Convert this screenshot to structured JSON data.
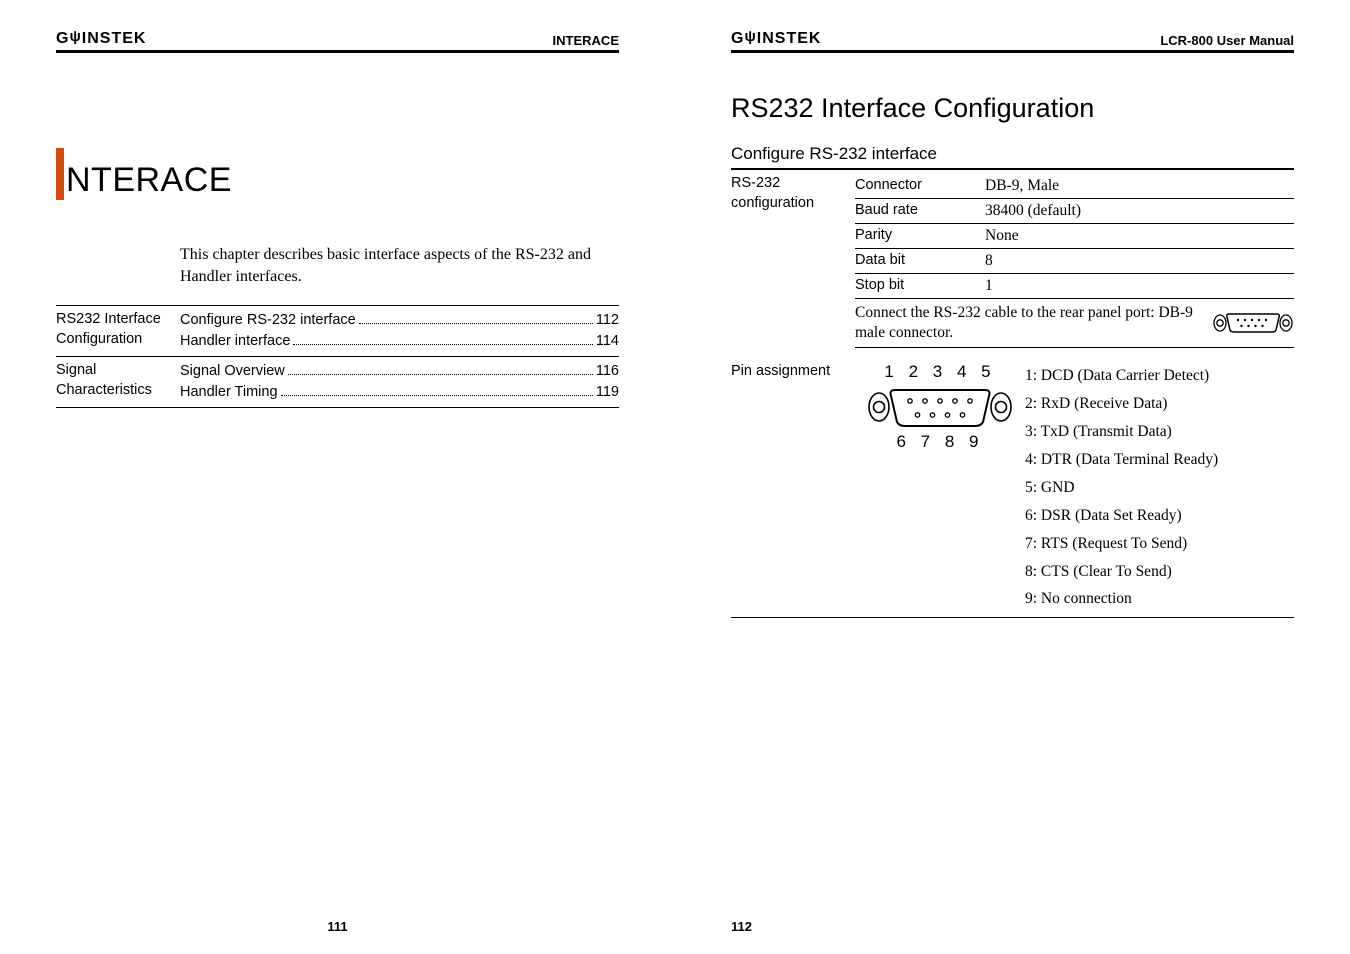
{
  "brand": "GWINSTEK",
  "left": {
    "hdr_right": "INTERACE",
    "chapter": "NTERACE",
    "intro": "This chapter describes basic interface aspects of the RS-232 and Handler interfaces.",
    "toc": [
      {
        "label": "RS232 Interface Configuration",
        "items": [
          {
            "title": "Configure RS-232 interface",
            "pg": "112"
          },
          {
            "title": "Handler interface",
            "pg": "114"
          }
        ]
      },
      {
        "label": "Signal Characteristics",
        "items": [
          {
            "title": "Signal Overview",
            "pg": "116"
          },
          {
            "title": "Handler Timing",
            "pg": "119"
          }
        ]
      }
    ],
    "footer": "111"
  },
  "right": {
    "hdr_right": "LCR-800 User Manual",
    "h1": "RS232 Interface Configuration",
    "h2": "Configure RS-232 interface",
    "spec_label": "RS-232 configuration",
    "spec": [
      {
        "k": "Connector",
        "v": "DB-9, Male"
      },
      {
        "k": "Baud rate",
        "v": "38400 (default)"
      },
      {
        "k": "Parity",
        "v": "None"
      },
      {
        "k": "Data bit",
        "v": "8"
      },
      {
        "k": "Stop bit",
        "v": "1"
      }
    ],
    "cable": "Connect the RS-232 cable to the rear panel port: DB-9 male connector.",
    "pin_label": "Pin assignment",
    "pin_top": "1 2 3 4 5",
    "pin_bot": "6 7 8 9",
    "pins": [
      "1: DCD (Data Carrier Detect)",
      "2: RxD (Receive Data)",
      "3: TxD (Transmit Data)",
      "4: DTR (Data Terminal Ready)",
      "5: GND",
      "6: DSR (Data Set Ready)",
      "7: RTS (Request To Send)",
      "8: CTS (Clear To Send)",
      "9: No connection"
    ],
    "footer": "112"
  }
}
